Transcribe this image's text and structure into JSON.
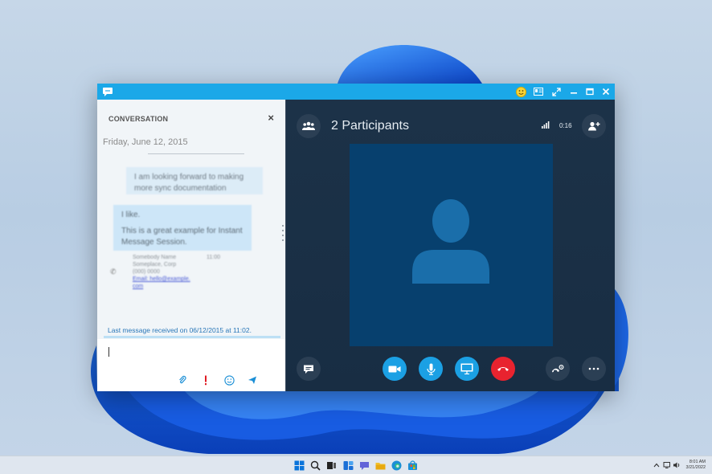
{
  "window": {
    "controls": [
      "emoji-button",
      "layout-button",
      "expand-button",
      "minimize-button",
      "maximize-button",
      "close-button"
    ]
  },
  "conversation": {
    "header": "CONVERSATION",
    "close_glyph": "×",
    "date": "Friday, June 12, 2015",
    "messages": [
      {
        "text": "I am looking forward to making more sync documentation"
      },
      {
        "line1": "I like.",
        "line2": "This is a great example for Instant Message Session."
      }
    ],
    "contact_card": {
      "lines": [
        "Somebody Name",
        "Someplace, Corp",
        "(000) 0000",
        "Email: hello@example.",
        "com"
      ],
      "time": "11:00"
    },
    "last_message": "Last message received on 06/12/2015 at 11:02."
  },
  "video": {
    "participants_title": "2 Participants",
    "duration": "0:16",
    "colors": {
      "hangup": "#e8232f",
      "action": "#1ba0e4",
      "tile": "#07406e"
    }
  },
  "taskbar": {
    "time": "8:01 AM",
    "date": "3/21/2022"
  }
}
